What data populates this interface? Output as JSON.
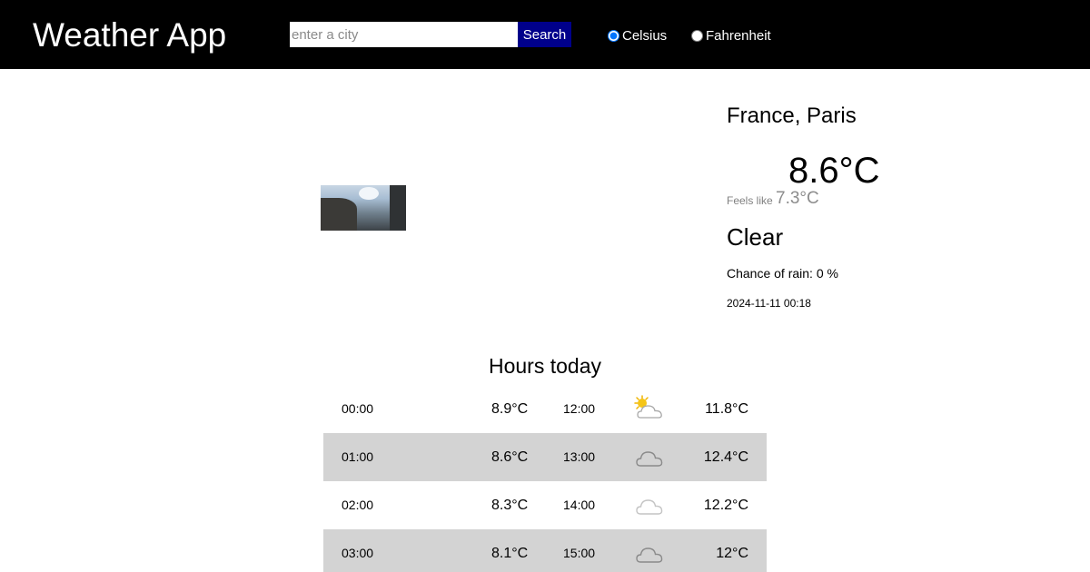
{
  "header": {
    "title": "Weather App",
    "search_placeholder": "enter a city",
    "search_value": "",
    "search_button_label": "Search",
    "units": [
      {
        "label": "Celsius",
        "selected": true
      },
      {
        "label": "Fahrenheit",
        "selected": false
      }
    ]
  },
  "current": {
    "location": "France, Paris",
    "icon": "moon-icon",
    "temperature": "8.6°C",
    "feels_like_label": "Feels like",
    "feels_like_value": "7.3°C",
    "condition": "Clear",
    "rain_label": "Chance of rain:",
    "rain_value": "0 %",
    "timestamp": "2024-11-11 00:18"
  },
  "hours": {
    "title": "Hours today",
    "rows": [
      {
        "time_a": "00:00",
        "icon_a": "moon-icon",
        "temp_a": "8.9°C",
        "time_b": "12:00",
        "icon_b": "sun-behind-cloud-icon",
        "temp_b": "11.8°C"
      },
      {
        "time_a": "01:00",
        "icon_a": "moon-icon",
        "temp_a": "8.6°C",
        "time_b": "13:00",
        "icon_b": "cloud-icon",
        "temp_b": "12.4°C"
      },
      {
        "time_a": "02:00",
        "icon_a": "moon-icon",
        "temp_a": "8.3°C",
        "time_b": "14:00",
        "icon_b": "light-cloud-icon",
        "temp_b": "12.2°C"
      },
      {
        "time_a": "03:00",
        "icon_a": "moon-icon",
        "temp_a": "8.1°C",
        "time_b": "15:00",
        "icon_b": "cloud-icon",
        "temp_b": "12°C"
      }
    ]
  },
  "colors": {
    "header_bg": "#000000",
    "search_button_bg": "#00008b",
    "alt_row_bg": "#d3d3d3",
    "moon_icon": "#1a73c8",
    "secondary_text": "#808080"
  }
}
